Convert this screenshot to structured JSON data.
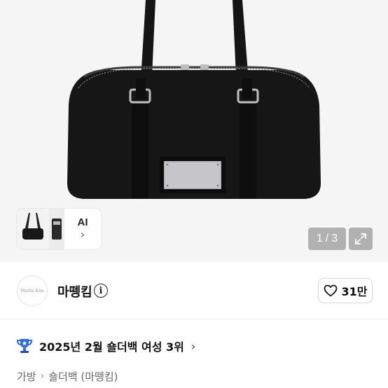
{
  "gallery": {
    "ai_label": "AI",
    "ai_chevron": "›",
    "current_page": "1",
    "page_separator": "/",
    "total_pages": "3",
    "icons": [
      "expand-icon",
      "chevron-right-icon"
    ]
  },
  "seller": {
    "avatar_text": "Mattis Kim",
    "shop_name": "마뗑킴",
    "info_icon": "i",
    "like_count": "31만",
    "icons": [
      "heart-icon",
      "info-icon"
    ]
  },
  "ranking": {
    "text": "2025년 2월 숄더백 여성 3위",
    "chevron": "›",
    "icon": "trophy-icon",
    "trophy_color": "#2d6cdf"
  },
  "breadcrumb": {
    "items": [
      "가방",
      "숄더백 (마뗑킴)"
    ],
    "separator": "›"
  }
}
